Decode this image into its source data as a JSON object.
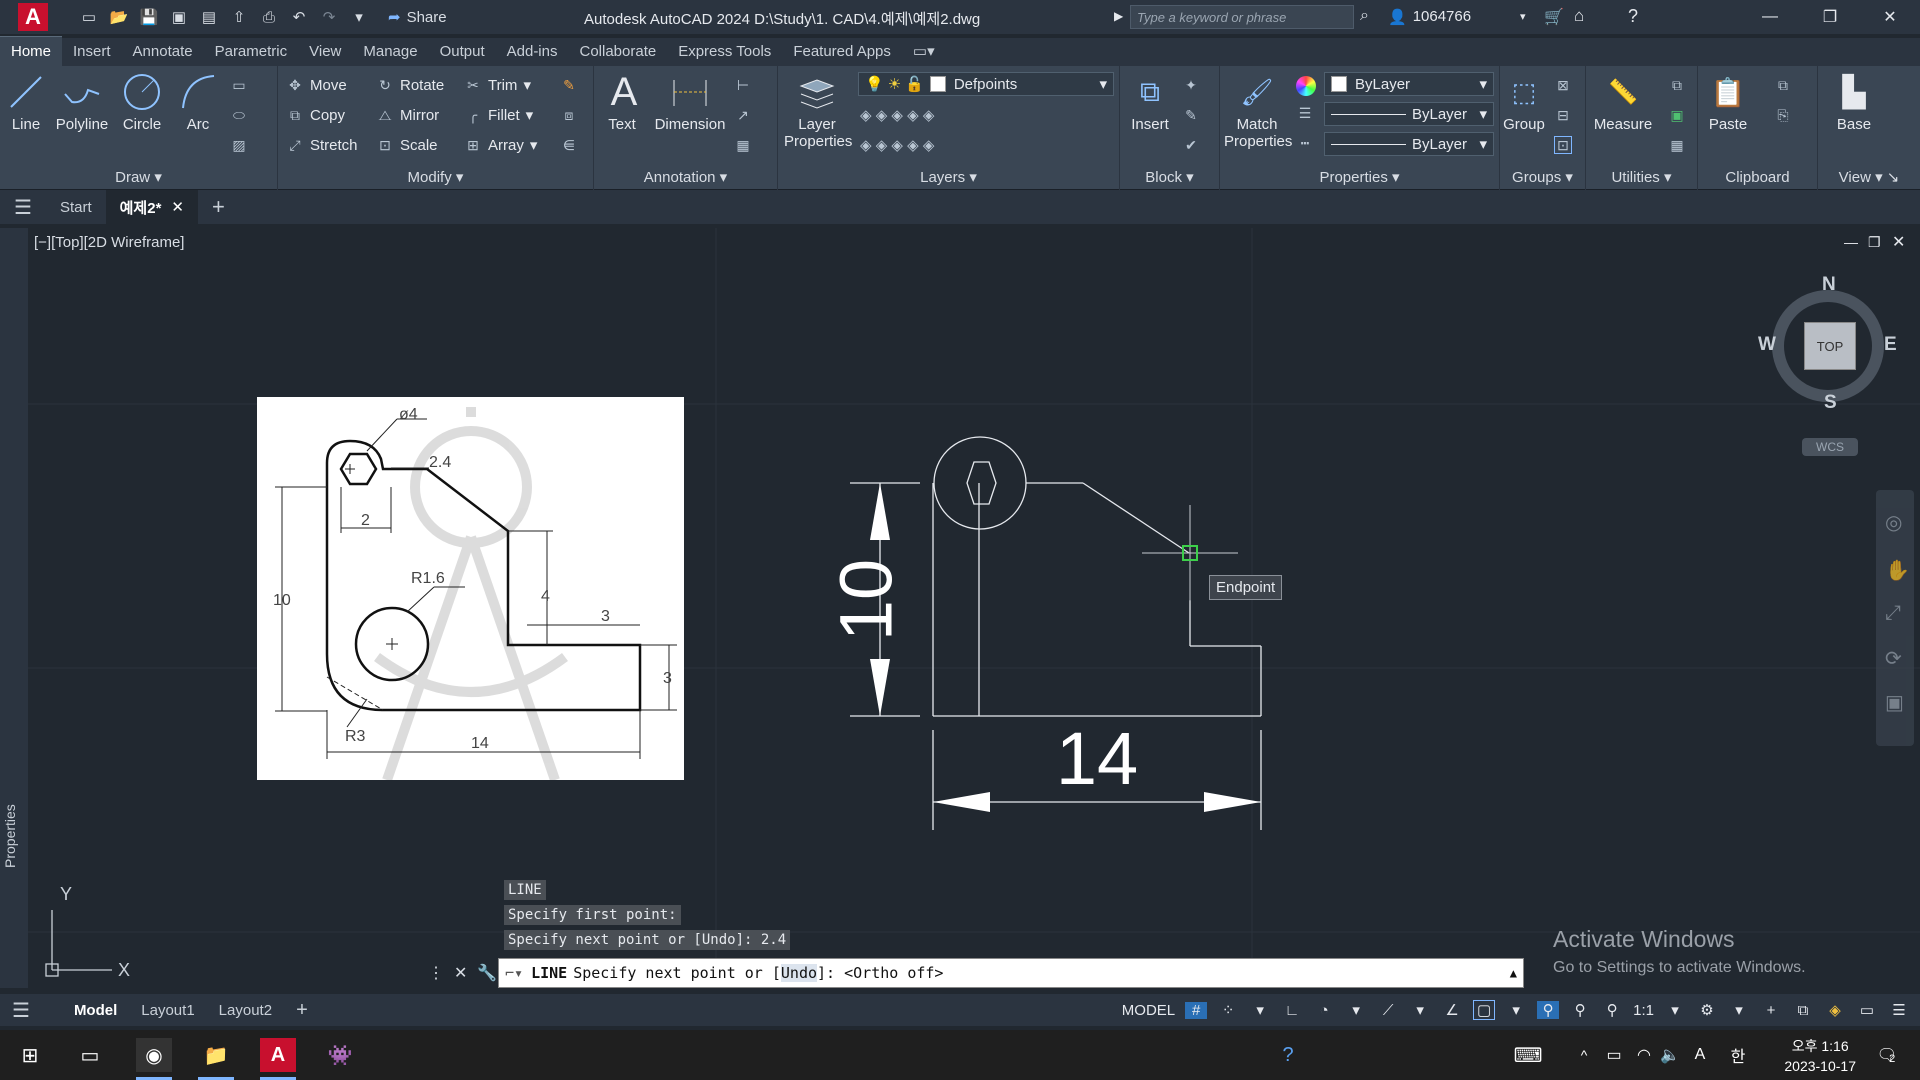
{
  "titlebar": {
    "logo": "A",
    "share_label": "Share",
    "title": "Autodesk AutoCAD 2024    D:\\Study\\1. CAD\\4.예제\\예제2.dwg",
    "search_placeholder": "Type a keyword or phrase",
    "user": "1064766"
  },
  "ribbon_tabs": [
    "Home",
    "Insert",
    "Annotate",
    "Parametric",
    "View",
    "Manage",
    "Output",
    "Add-ins",
    "Collaborate",
    "Express Tools",
    "Featured Apps"
  ],
  "ribbon": {
    "draw": {
      "label": "Draw",
      "line": "Line",
      "polyline": "Polyline",
      "circle": "Circle",
      "arc": "Arc"
    },
    "modify": {
      "label": "Modify",
      "move": "Move",
      "rotate": "Rotate",
      "trim": "Trim",
      "copy": "Copy",
      "mirror": "Mirror",
      "fillet": "Fillet",
      "stretch": "Stretch",
      "scale": "Scale",
      "array": "Array"
    },
    "annotation": {
      "label": "Annotation",
      "text": "Text",
      "dimension": "Dimension"
    },
    "layers": {
      "label": "Layers",
      "layer_properties": "Layer Properties",
      "current_layer": "Defpoints"
    },
    "block": {
      "label": "Block",
      "insert": "Insert"
    },
    "properties": {
      "label": "Properties",
      "match": "Match Properties",
      "color": "ByLayer",
      "linetype": "ByLayer",
      "lineweight": "ByLayer"
    },
    "groups": {
      "label": "Groups",
      "group": "Group"
    },
    "utilities": {
      "label": "Utilities",
      "measure": "Measure"
    },
    "clipboard": {
      "label": "Clipboard",
      "paste": "Paste"
    },
    "view": {
      "label": "View",
      "base": "Base"
    }
  },
  "file_tabs": {
    "start": "Start",
    "current": "예제2*"
  },
  "viewport": {
    "label": "[−][Top][2D Wireframe]",
    "properties_palette": "Properties",
    "viewcube": {
      "n": "N",
      "s": "S",
      "e": "E",
      "w": "W",
      "face": "TOP",
      "wcs": "WCS"
    },
    "ucs": {
      "x": "X",
      "y": "Y"
    },
    "tooltip": "Endpoint"
  },
  "reference_image": {
    "dim_phi4": "ø4",
    "dim_2_4": "2.4",
    "dim_2": "2",
    "dim_r1_6": "R1.6",
    "dim_10": "10",
    "dim_4": "4",
    "dim_3_top": "3",
    "dim_3_right": "3",
    "dim_r3": "R3",
    "dim_14": "14"
  },
  "drawing": {
    "dim_10": "10",
    "dim_14": "14"
  },
  "command": {
    "history": [
      "LINE",
      "Specify first point:",
      "Specify next point or [Undo]: 2.4"
    ],
    "prompt_cmd": "LINE",
    "prompt_text": "Specify next point or [",
    "prompt_option": "Undo",
    "prompt_tail": "]:  <Ortho off>"
  },
  "watermark": {
    "title": "Activate Windows",
    "subtitle": "Go to Settings to activate Windows."
  },
  "layout_tabs": [
    "Model",
    "Layout1",
    "Layout2"
  ],
  "status": {
    "model": "MODEL",
    "scale": "1:1"
  },
  "taskbar": {
    "time": "오후 1:16",
    "date": "2023-10-17",
    "notifications": "2",
    "ime": "한",
    "lang": "A"
  }
}
